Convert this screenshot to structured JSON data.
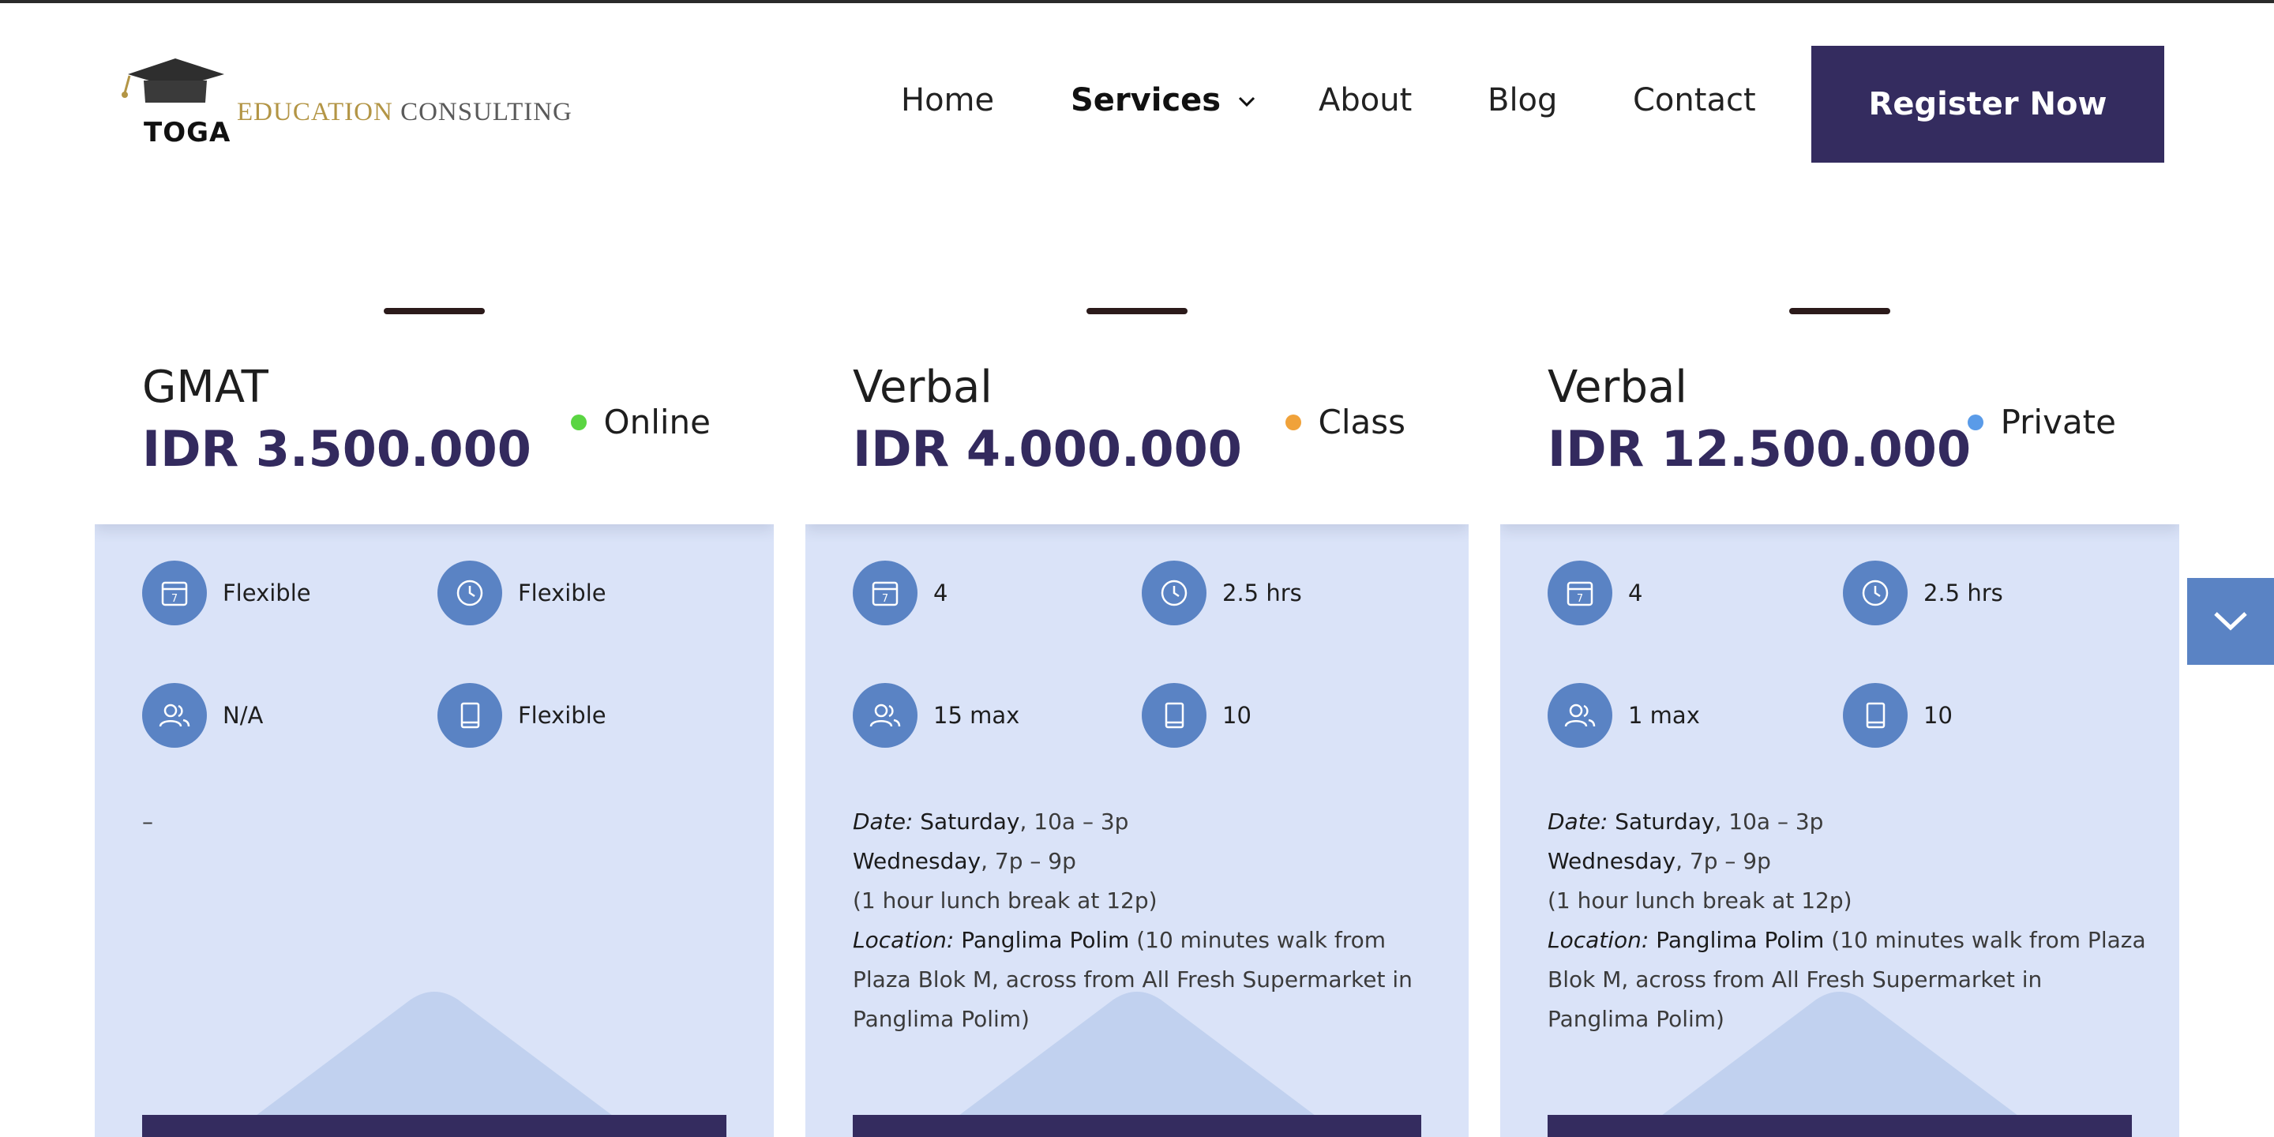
{
  "header": {
    "logo": {
      "mark": "TOGA",
      "tagline_gold": "EDUCATION",
      "tagline_gray": "CONSULTING"
    },
    "nav": [
      {
        "label": "Home"
      },
      {
        "label": "Services"
      },
      {
        "label": "About"
      },
      {
        "label": "Blog"
      },
      {
        "label": "Contact"
      }
    ],
    "register_label": "Register Now"
  },
  "colors": {
    "brand": "#342c5f",
    "card_bg": "#dae3f8",
    "icon_bg": "#5a83c4",
    "online": "#5ad542",
    "class": "#f0a23a",
    "private": "#5a9be8"
  },
  "cards": [
    {
      "title": "GMAT",
      "price": "IDR 3.500.000",
      "badge": "Online",
      "features": {
        "sessions": "Flexible",
        "duration": "Flexible",
        "students": "N/A",
        "books": "Flexible"
      },
      "desc_placeholder": "–"
    },
    {
      "title": "Verbal",
      "price": "IDR 4.000.000",
      "badge": "Class",
      "features": {
        "sessions": "4",
        "duration": "2.5 hrs",
        "students": "15 max",
        "books": "10"
      },
      "date_label": "Date:",
      "day1": "Saturday",
      "time1": ", 10a – 3p",
      "day2": "Wednesday",
      "time2": ", 7p – 9p",
      "lunch": "(1 hour lunch break at 12p)",
      "location_label": "Location:",
      "location_name": "Panglima Polim",
      "location_detail": " (10 minutes walk from Plaza Blok M, across from All Fresh Supermarket in Panglima Polim)"
    },
    {
      "title": "Verbal",
      "price": "IDR 12.500.000",
      "badge": "Private",
      "features": {
        "sessions": "4",
        "duration": "2.5 hrs",
        "students": "1 max",
        "books": "10"
      },
      "date_label": "Date:",
      "day1": "Saturday",
      "time1": ", 10a – 3p",
      "day2": "Wednesday",
      "time2": ", 7p – 9p",
      "lunch": "(1 hour lunch break at 12p)",
      "location_label": "Location:",
      "location_name": "Panglima Polim",
      "location_detail": " (10 minutes walk from Plaza Blok M, across from All Fresh Supermarket in Panglima Polim)"
    }
  ],
  "icons": {
    "sessions": "calendar-icon",
    "duration": "clock-icon",
    "students": "users-icon",
    "books": "book-icon",
    "scroll": "chevron-down-icon"
  }
}
